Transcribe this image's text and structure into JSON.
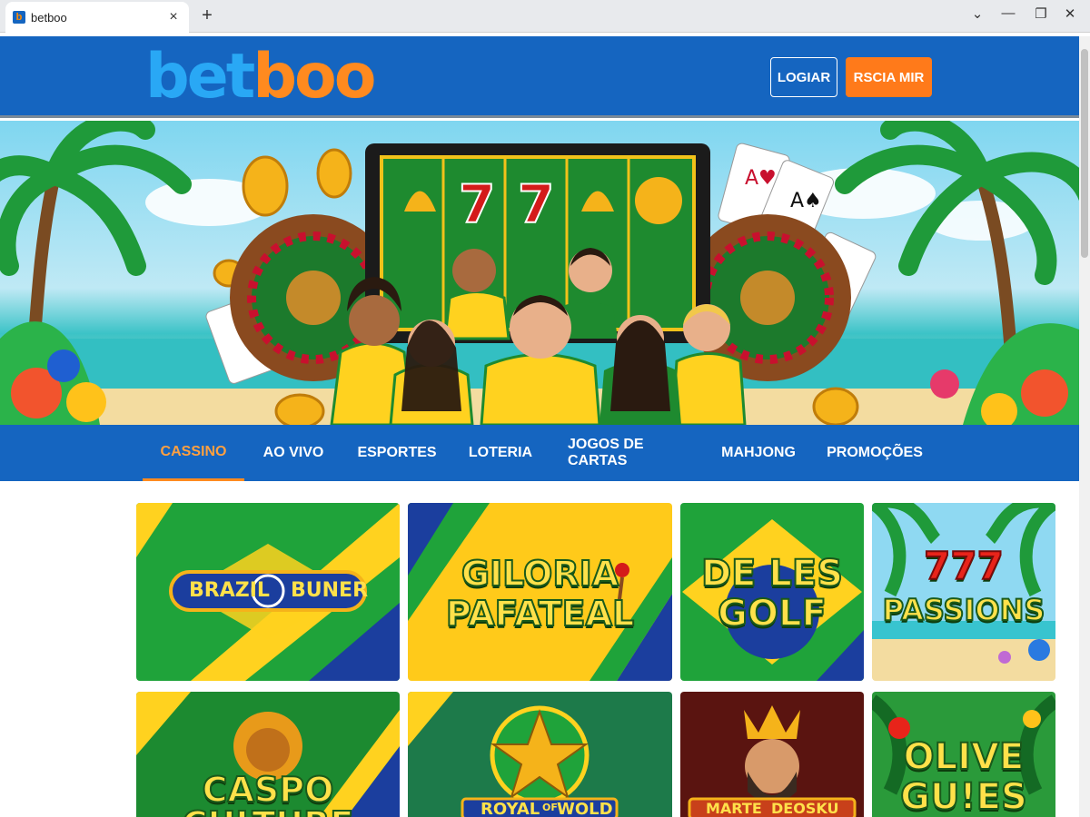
{
  "browser": {
    "tab_title": "betboo",
    "favicon_letter": "b",
    "close_glyph": "×",
    "newtab_glyph": "+",
    "controls": {
      "dropdown": "⌄",
      "minimize": "—",
      "restore": "❐",
      "close": "✕"
    }
  },
  "header": {
    "logo_part1": "bet",
    "logo_part2": "boo",
    "login_label": "LOGIAR",
    "register_label": "RSCIA MIR"
  },
  "nav": {
    "items": [
      "CASSINO",
      "AO VIVO",
      "ESPORTES",
      "LOTERIA",
      "JOGOS DE CARTAS",
      "MAHJONG",
      "PROMOÇÕES"
    ],
    "active": "CASSINO"
  },
  "games": [
    {
      "title_line1": "BRAZIL",
      "title_line2": "BUNER"
    },
    {
      "title_line1": "GILORIA",
      "title_line2": "PAFATEAL"
    },
    {
      "title_line1": "DE LES",
      "title_line2": "GOLF"
    },
    {
      "title_line1": "777",
      "title_line2": "PASSIONS"
    },
    {
      "title_line1": "CASPO",
      "title_line2": "CULTURE"
    },
    {
      "title_line1": "ROYAL",
      "title_line_small": "OF",
      "title_line2": "WOLD"
    },
    {
      "title_line1": "MARTE",
      "title_line2": "DEOSKU"
    },
    {
      "title_line1": "OLIVE",
      "title_line2": "GU!ES"
    }
  ],
  "colors": {
    "brand_blue": "#1565c0",
    "accent_orange": "#ff7a1a",
    "brazil_green": "#1fa33a",
    "brazil_yellow": "#ffd21f"
  }
}
